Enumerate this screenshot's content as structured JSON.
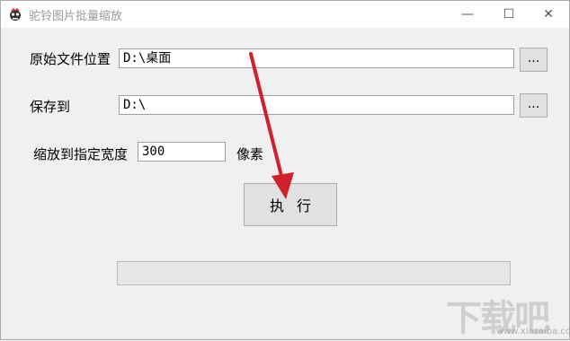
{
  "window": {
    "title": "驼铃图片批量缩放",
    "controls": {
      "minimize": "—",
      "maximize": "☐",
      "close": "✕"
    }
  },
  "form": {
    "source_label": "原始文件位置",
    "source_value": "D:\\桌面",
    "browse_label": "...",
    "save_label": "保存到",
    "save_value": "D:\\",
    "width_label": "缩放到指定宽度",
    "width_value": "300",
    "unit_label": "像素",
    "execute_label": "执行"
  },
  "progress": {
    "value": 0
  },
  "watermark": {
    "text": "下载吧",
    "url": "www.xiazaiba.com"
  },
  "colors": {
    "arrow": "#d0202a",
    "progress_fill": "#06b025"
  }
}
